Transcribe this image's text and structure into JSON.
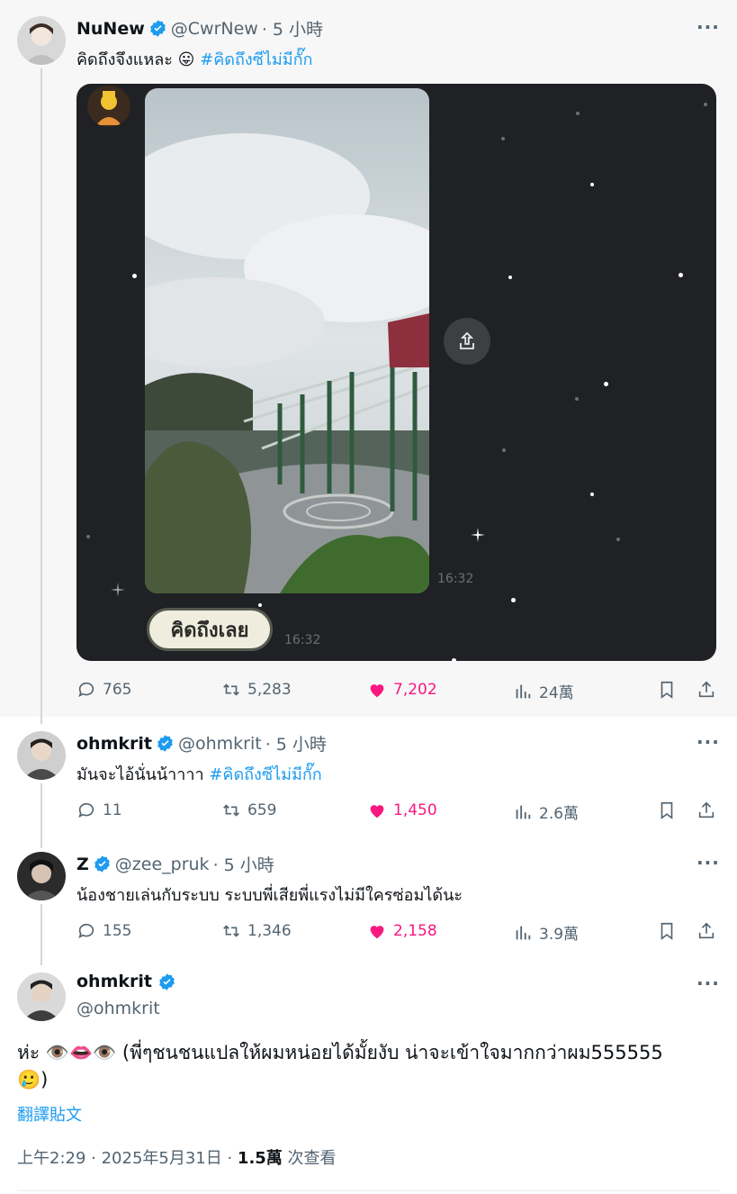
{
  "colors": {
    "verified": "#1d9bf0",
    "like": "#f91880",
    "muted": "#536471",
    "link": "#1d9bf0"
  },
  "tweets": [
    {
      "name": "NuNew",
      "handle": "@CwrNew",
      "time": "· 5 小時",
      "text": "คิดถึงจึงแหละ 😛",
      "hashtag": "#คิดถึงซีไม่มีกั๊ก",
      "media": {
        "photo_time": "16:32",
        "sticker_text": "คิดถึงเลย",
        "sticker_time": "16:32"
      },
      "stats": {
        "replies": "765",
        "retweets": "5,283",
        "likes": "7,202",
        "views": "24萬"
      }
    },
    {
      "name": "ohmkrit",
      "handle": "@ohmkrit",
      "time": "· 5 小時",
      "text": "มันจะไอ้นั่นน้าาาา",
      "hashtag": "#คิดถึงซีไม่มีกั๊ก",
      "stats": {
        "replies": "11",
        "retweets": "659",
        "likes": "1,450",
        "views": "2.6萬"
      }
    },
    {
      "name": "Z",
      "handle": "@zee_pruk",
      "time": "· 5 小時",
      "text": "น้องชายเล่นกับระบบ ระบบพี่เสียพี่แรงไม่มีใครซ่อมได้นะ",
      "stats": {
        "replies": "155",
        "retweets": "1,346",
        "likes": "2,158",
        "views": "3.9萬"
      }
    }
  ],
  "main": {
    "name": "ohmkrit",
    "handle": "@ohmkrit",
    "text_line1": "ห่ะ 👁️👄👁️ (พี่ๆชนชนแปลให้ผมหน่อยได้มั้ยงับ น่าจะเข้าใจมากกว่าผม555555",
    "text_line2": "🥲)",
    "translate": "翻譯貼文",
    "timestamp": "上午2:29 · 2025年5月31日 · ",
    "views_count": "1.5萬",
    "views_label": " 次查看"
  }
}
